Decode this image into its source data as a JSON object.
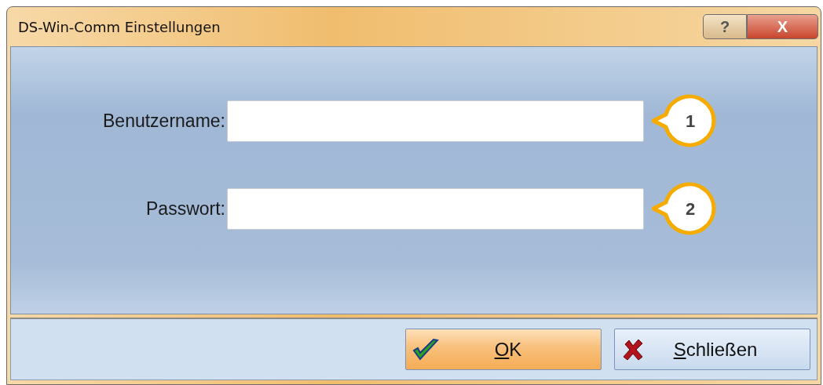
{
  "window": {
    "title": "DS-Win-Comm Einstellungen",
    "controls": [
      {
        "kind": "help",
        "label": "?"
      },
      {
        "kind": "close",
        "label": "X"
      }
    ]
  },
  "fields": [
    {
      "label": "Benutzername:",
      "callout": "1"
    },
    {
      "label": "Passwort:",
      "callout": "2"
    }
  ],
  "buttons": [
    {
      "kind": "ok",
      "label": "OK"
    },
    {
      "kind": "close",
      "label": "Schließen"
    }
  ]
}
